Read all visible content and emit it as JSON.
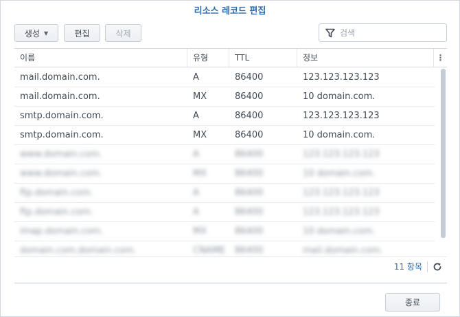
{
  "dialog": {
    "title": "리소스 레코드 편집"
  },
  "toolbar": {
    "create_label": "생성",
    "edit_label": "편집",
    "delete_label": "삭제"
  },
  "search": {
    "placeholder": "검색"
  },
  "table": {
    "columns": [
      "이름",
      "유형",
      "TTL",
      "정보"
    ],
    "rows": [
      {
        "name": "mail.domain.com.",
        "type": "A",
        "ttl": "86400",
        "info": "123.123.123.123"
      },
      {
        "name": "mail.domain.com.",
        "type": "MX",
        "ttl": "86400",
        "info": "10 domain.com."
      },
      {
        "name": "smtp.domain.com.",
        "type": "A",
        "ttl": "86400",
        "info": "123.123.123.123"
      },
      {
        "name": "smtp.domain.com.",
        "type": "MX",
        "ttl": "86400",
        "info": "10 domain.com."
      },
      {
        "name": "www.domain.com.",
        "type": "A",
        "ttl": "86400",
        "info": "123.123.123.123"
      },
      {
        "name": "www.domain.com.",
        "type": "MX",
        "ttl": "86400",
        "info": "10 domain.com."
      },
      {
        "name": "ftp.domain.com.",
        "type": "A",
        "ttl": "86400",
        "info": "123.123.123.123"
      },
      {
        "name": "ftp.domain.com.",
        "type": "A",
        "ttl": "86400",
        "info": "123.123.123.123"
      },
      {
        "name": "imap.domain.com.",
        "type": "MX",
        "ttl": "86400",
        "info": "10 domain.com."
      },
      {
        "name": "domain.com.domain.com.",
        "type": "CNAME",
        "ttl": "86400",
        "info": "mail.domain.com."
      }
    ]
  },
  "footer": {
    "count_label": "11 항목",
    "close_label": "종료"
  },
  "colors": {
    "accent": "#2a6aab",
    "border": "#d3d8de",
    "text": "#414b55"
  }
}
